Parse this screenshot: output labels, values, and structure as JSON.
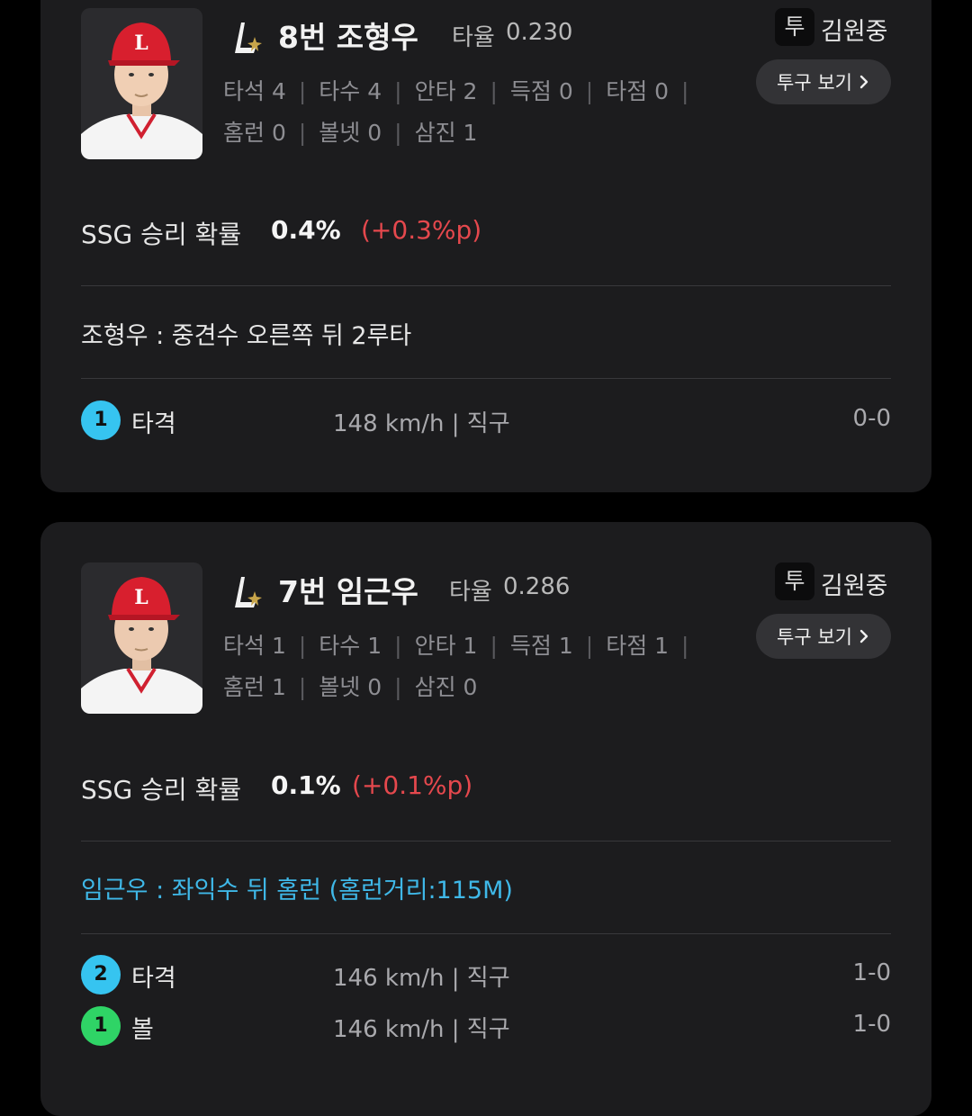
{
  "colors": {
    "background": "#000000",
    "card": "#1c1c1e",
    "strike_circle": "#36c4f0",
    "ball_circle": "#2fd466",
    "positive_delta": "#e5484d",
    "home_run_text": "#3fb8e8"
  },
  "icons": {
    "team_logo": "lotte-giants-logo-icon",
    "chevron": "chevron-right-icon"
  },
  "cards": [
    {
      "batter": {
        "name": "8번 조형우",
        "avg_label": "타율",
        "avg_value": "0.230",
        "stats": [
          "타석 4",
          "타수 4",
          "안타 2",
          "득점 0",
          "타점 0",
          "홈런 0",
          "볼넷 0",
          "삼진 1"
        ]
      },
      "pitcher": {
        "badge": "투",
        "name": "김원중",
        "button_label": "투구 보기"
      },
      "win_prob": {
        "label": "SSG 승리 확률",
        "value": "0.4%",
        "delta": "(+0.3%p)"
      },
      "play_text": "조형우 : 중견수 오른쪽 뒤 2루타",
      "pitches": [
        {
          "num": "1",
          "type": "strike",
          "result": "타격",
          "info": "148 km/h | 직구",
          "count": "0-0"
        }
      ]
    },
    {
      "batter": {
        "name": "7번 임근우",
        "avg_label": "타율",
        "avg_value": "0.286",
        "stats": [
          "타석 1",
          "타수 1",
          "안타 1",
          "득점 1",
          "타점 1",
          "홈런 1",
          "볼넷 0",
          "삼진 0"
        ]
      },
      "pitcher": {
        "badge": "투",
        "name": "김원중",
        "button_label": "투구 보기"
      },
      "win_prob": {
        "label": "SSG 승리 확률",
        "value": "0.1%",
        "delta": "(+0.1%p)"
      },
      "play_text": "임근우 : 좌익수 뒤 홈런 (홈런거리:115M)",
      "pitches": [
        {
          "num": "2",
          "type": "strike",
          "result": "타격",
          "info": "146 km/h | 직구",
          "count": "1-0"
        },
        {
          "num": "1",
          "type": "ball",
          "result": "볼",
          "info": "146 km/h | 직구",
          "count": "1-0"
        }
      ]
    }
  ]
}
